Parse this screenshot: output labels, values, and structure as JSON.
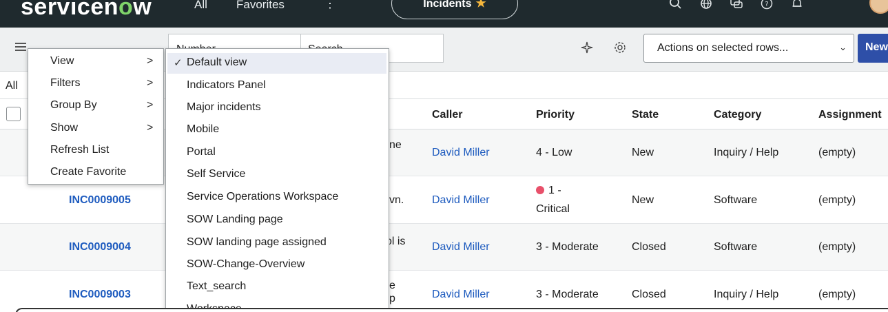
{
  "topnav": {
    "logo_text_a": "servicen",
    "logo_text_o": "o",
    "logo_text_b": "w",
    "all_label": "All",
    "favorites_label": "Favorites",
    "more_label": "⋮",
    "context_pill": "Incidents",
    "pill_star": "★",
    "icons": [
      "search-icon",
      "globe-icon",
      "chat-icon",
      "help-icon",
      "bell-icon",
      "avatar"
    ]
  },
  "toolbar": {
    "field_select_value": "Number",
    "search_placeholder": "Search",
    "actions_select_label": "Actions on selected rows...",
    "new_button_label": "New"
  },
  "breadcrumb": {
    "all_label": "All"
  },
  "table": {
    "headers": [
      "Caller",
      "Priority",
      "State",
      "Category",
      "Assignment"
    ],
    "rows": [
      {
        "number": "",
        "desc_frag": "ne",
        "caller": "David Miller",
        "priority": "4 - Low",
        "critical": false,
        "state": "New",
        "category": "Inquiry / Help",
        "assignment": "(empty)"
      },
      {
        "number": "INC0009005",
        "desc_frag": "vn.",
        "caller": "David Miller",
        "priority_line1": "1 -",
        "priority_line2": "Critical",
        "critical": true,
        "state": "New",
        "category": "Software",
        "assignment": "(empty)"
      },
      {
        "number": "INC0009004",
        "desc_frag": "ol is",
        "caller": "David Miller",
        "priority": "3 - Moderate",
        "critical": false,
        "state": "Closed",
        "category": "Software",
        "assignment": "(empty)"
      },
      {
        "number": "INC0009003",
        "desc_frag": "e",
        "desc_frag2": "p",
        "caller": "David Miller",
        "priority": "3 - Moderate",
        "critical": false,
        "state": "Closed",
        "category": "Inquiry / Help",
        "assignment": "(empty)"
      }
    ]
  },
  "context_menu": {
    "items": [
      "View",
      "Filters",
      "Group By",
      "Show",
      "Refresh List",
      "Create Favorite"
    ],
    "submenu_arrow": ">"
  },
  "view_submenu": {
    "check": "✓",
    "items": [
      "Default view",
      "Indicators Panel",
      "Major incidents",
      "Mobile",
      "Portal",
      "Self Service",
      "Service Operations Workspace",
      "SOW Landing page",
      "SOW landing page assigned",
      "SOW-Change-Overview",
      "Text_search",
      "Workspace"
    ]
  },
  "colors": {
    "nav_bg": "#1f2a2e",
    "brand_green": "#7fd36a",
    "link_blue": "#1f5cbf",
    "primary_button": "#2e4fa8",
    "critical_dot": "#e8506a"
  }
}
